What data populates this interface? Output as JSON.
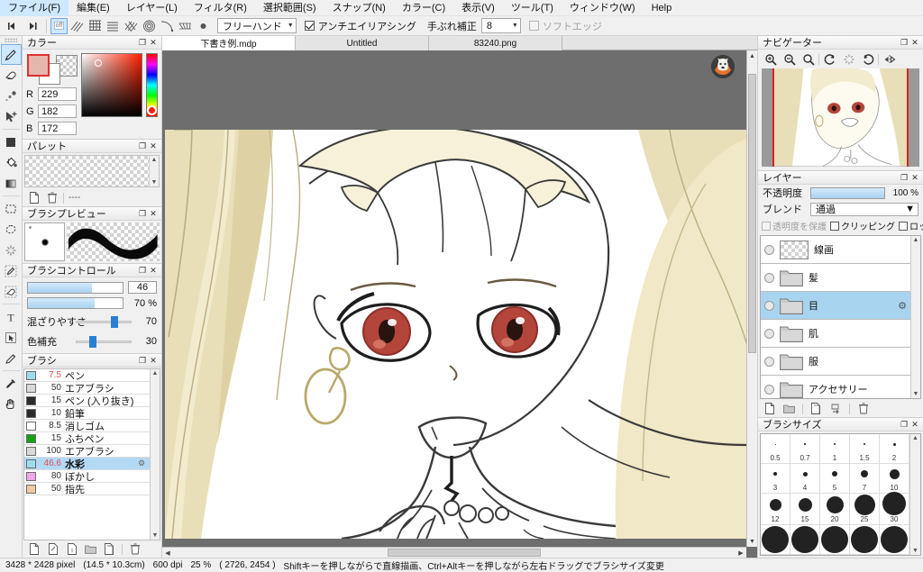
{
  "menu": {
    "items": [
      {
        "label": "ファイル(F)",
        "name": "menu-file"
      },
      {
        "label": "編集(E)",
        "name": "menu-edit"
      },
      {
        "label": "レイヤー(L)",
        "name": "menu-layer"
      },
      {
        "label": "フィルタ(R)",
        "name": "menu-filter"
      },
      {
        "label": "選択範囲(S)",
        "name": "menu-select"
      },
      {
        "label": "スナップ(N)",
        "name": "menu-snap"
      },
      {
        "label": "カラー(C)",
        "name": "menu-color"
      },
      {
        "label": "表示(V)",
        "name": "menu-view"
      },
      {
        "label": "ツール(T)",
        "name": "menu-tool"
      },
      {
        "label": "ウィンドウ(W)",
        "name": "menu-window"
      },
      {
        "label": "Help",
        "name": "menu-help"
      }
    ]
  },
  "toolbar": {
    "snap_icons": [
      {
        "name": "snap-off-icon",
        "label": "off",
        "selected": true
      },
      {
        "name": "snap-parallel-icon",
        "label": "",
        "selected": false
      },
      {
        "name": "snap-grid-icon",
        "label": "",
        "selected": false
      },
      {
        "name": "snap-horizontal-icon",
        "label": "",
        "selected": false
      },
      {
        "name": "snap-crosshatch-icon",
        "label": "",
        "selected": false
      },
      {
        "name": "snap-radial-icon",
        "label": "",
        "selected": false
      },
      {
        "name": "snap-curve-icon",
        "label": "",
        "selected": false
      },
      {
        "name": "snap-perspective-icon",
        "label": "",
        "selected": false
      },
      {
        "name": "snap-point-icon",
        "label": "",
        "selected": false
      }
    ],
    "shape_mode": "フリーハンド",
    "antialias_label": "アンチエイリアシング",
    "antialias_checked": true,
    "stabilizer_label": "手ぶれ補正",
    "stabilizer_value": "8",
    "softedge_label": "ソフトエッジ",
    "softedge_checked": false
  },
  "tools": {
    "items": [
      {
        "name": "tool-pencil",
        "icon": "pencil-icon",
        "selected": true
      },
      {
        "name": "tool-eraser",
        "icon": "eraser-icon",
        "selected": false
      },
      {
        "name": "tool-blur",
        "icon": "blur-icon",
        "selected": false
      },
      {
        "name": "tool-move-select",
        "icon": "move-arrow-icon",
        "selected": false
      },
      {
        "name": "tool-fill",
        "icon": "fill-square-icon",
        "selected": false
      },
      {
        "name": "tool-bucket",
        "icon": "paint-bucket-icon",
        "selected": false
      },
      {
        "name": "tool-gradient",
        "icon": "gradient-icon",
        "selected": false
      },
      {
        "name": "tool-rect-select",
        "icon": "rect-select-icon",
        "selected": false
      },
      {
        "name": "tool-lasso-select",
        "icon": "lasso-icon",
        "selected": false
      },
      {
        "name": "tool-magic-wand",
        "icon": "magic-wand-icon",
        "selected": false
      },
      {
        "name": "tool-select-pen",
        "icon": "select-pen-icon",
        "selected": false
      },
      {
        "name": "tool-select-eraser",
        "icon": "select-eraser-icon",
        "selected": false
      },
      {
        "name": "tool-text",
        "icon": "text-t-icon",
        "selected": false
      },
      {
        "name": "tool-operation",
        "icon": "cursor-select-icon",
        "selected": false
      },
      {
        "name": "tool-brush-alt",
        "icon": "brush-icon",
        "selected": false
      },
      {
        "name": "tool-eyedropper",
        "icon": "eyedropper-icon",
        "selected": false
      },
      {
        "name": "tool-hand",
        "icon": "hand-icon",
        "selected": false
      }
    ]
  },
  "color_panel": {
    "title": "カラー",
    "r_label": "R",
    "r_value": "229",
    "g_label": "G",
    "g_value": "182",
    "b_label": "B",
    "b_value": "172",
    "foreground_hex": "#e5b6ac",
    "background_hex": "#ffffff"
  },
  "palette_panel": {
    "title": "パレット",
    "dash_label": "----"
  },
  "brush_preview_panel": {
    "title": "ブラシプレビュー"
  },
  "brush_control_panel": {
    "title": "ブラシコントロール",
    "size_value": "46",
    "size_fill_pct": 68,
    "opacity_value": "70 %",
    "opacity_fill_pct": 70,
    "mix_label": "混ざりやすさ",
    "mix_value": "70",
    "mix_pos_pct": 70,
    "refill_label": "色補充",
    "refill_value": "30",
    "refill_pos_pct": 30
  },
  "brush_panel": {
    "title": "ブラシ",
    "items": [
      {
        "swatch": "#9fdcf0",
        "size": "7.5",
        "name": "ペン",
        "size_color": "#e05050",
        "selected": false
      },
      {
        "swatch": "#d9d9d9",
        "size": "50",
        "name": "エアブラシ",
        "size_color": "#333",
        "selected": false
      },
      {
        "swatch": "#2b2b2b",
        "size": "15",
        "name": "ペン (入り抜き)",
        "size_color": "#333",
        "selected": false
      },
      {
        "swatch": "#2b2b2b",
        "size": "10",
        "name": "鉛筆",
        "size_color": "#333",
        "selected": false
      },
      {
        "swatch": "#ffffff",
        "size": "8.5",
        "name": "消しゴム",
        "size_color": "#333",
        "selected": false
      },
      {
        "swatch": "#16a016",
        "size": "15",
        "name": "ふちペン",
        "size_color": "#333",
        "selected": false
      },
      {
        "swatch": "#d9d9d9",
        "size": "100",
        "name": "エアブラシ",
        "size_color": "#333",
        "selected": false
      },
      {
        "swatch": "#9fdcf0",
        "size": "46.6",
        "name": "水彩",
        "size_color": "#e05050",
        "selected": true
      },
      {
        "swatch": "#f2a8e8",
        "size": "80",
        "name": "ぼかし",
        "size_color": "#333",
        "selected": false
      },
      {
        "swatch": "#f0c9a0",
        "size": "50",
        "name": "指先",
        "size_color": "#333",
        "selected": false
      }
    ]
  },
  "tabs": {
    "items": [
      {
        "label": "下書き例.mdp",
        "active": true,
        "name": "tab-document-0"
      },
      {
        "label": "Untitled",
        "active": false,
        "name": "tab-document-1"
      },
      {
        "label": "83240.png",
        "active": false,
        "name": "tab-document-2"
      }
    ]
  },
  "navigator_panel": {
    "title": "ナビゲーター",
    "buttons": [
      {
        "name": "zoom-in-icon"
      },
      {
        "name": "zoom-out-icon"
      },
      {
        "name": "zoom-fit-icon"
      },
      {
        "name": "rotate-left-icon"
      },
      {
        "name": "rotate-reset-icon"
      },
      {
        "name": "rotate-right-icon"
      },
      {
        "name": "flip-horizontal-icon"
      }
    ]
  },
  "layers_panel": {
    "title": "レイヤー",
    "opacity_label": "不透明度",
    "opacity_value": "100 %",
    "blend_label": "ブレンド",
    "blend_value": "通過",
    "lock_alpha_label": "透明度を保護",
    "lock_alpha_checked": false,
    "clipping_label": "クリッピング",
    "clipping_checked": false,
    "lock_label": "ロック",
    "lock_checked": false,
    "items": [
      {
        "name": "線画",
        "type": "raster",
        "selected": false
      },
      {
        "name": "髪",
        "type": "folder",
        "selected": false
      },
      {
        "name": "目",
        "type": "folder",
        "selected": true
      },
      {
        "name": "肌",
        "type": "folder",
        "selected": false
      },
      {
        "name": "服",
        "type": "folder",
        "selected": false
      },
      {
        "name": "アクセサリー",
        "type": "folder",
        "selected": false
      }
    ],
    "buttons": [
      {
        "name": "add-layer-icon"
      },
      {
        "name": "add-folder-icon"
      },
      {
        "name": "duplicate-layer-icon"
      },
      {
        "name": "merge-layer-icon"
      },
      {
        "name": "delete-layer-icon"
      }
    ]
  },
  "brush_size_panel": {
    "title": "ブラシサイズ",
    "rows": [
      [
        {
          "label": "0.5",
          "dot": 1
        },
        {
          "label": "0.7",
          "dot": 1.5
        },
        {
          "label": "1",
          "dot": 2
        },
        {
          "label": "1.5",
          "dot": 2.5
        },
        {
          "label": "2",
          "dot": 3
        }
      ],
      [
        {
          "label": "3",
          "dot": 4
        },
        {
          "label": "4",
          "dot": 5
        },
        {
          "label": "5",
          "dot": 6.5
        },
        {
          "label": "7",
          "dot": 8.5
        },
        {
          "label": "10",
          "dot": 11
        }
      ],
      [
        {
          "label": "12",
          "dot": 13
        },
        {
          "label": "15",
          "dot": 15
        },
        {
          "label": "20",
          "dot": 19
        },
        {
          "label": "25",
          "dot": 23
        },
        {
          "label": "30",
          "dot": 26
        }
      ],
      [
        {
          "label": "",
          "dot": 30
        },
        {
          "label": "",
          "dot": 30
        },
        {
          "label": "",
          "dot": 30
        },
        {
          "label": "",
          "dot": 30
        },
        {
          "label": "",
          "dot": 30
        }
      ]
    ]
  },
  "statusbar": {
    "dimensions": "3428 * 2428 pixel",
    "physical": "(14.5 * 10.3cm)",
    "dpi": "600 dpi",
    "zoom": "25 %",
    "cursor": "( 2726, 2454 )",
    "hint": "Shiftキーを押しながらで直線描画、Ctrl+Altキーを押しながら左右ドラッグでブラシサイズ変更"
  }
}
